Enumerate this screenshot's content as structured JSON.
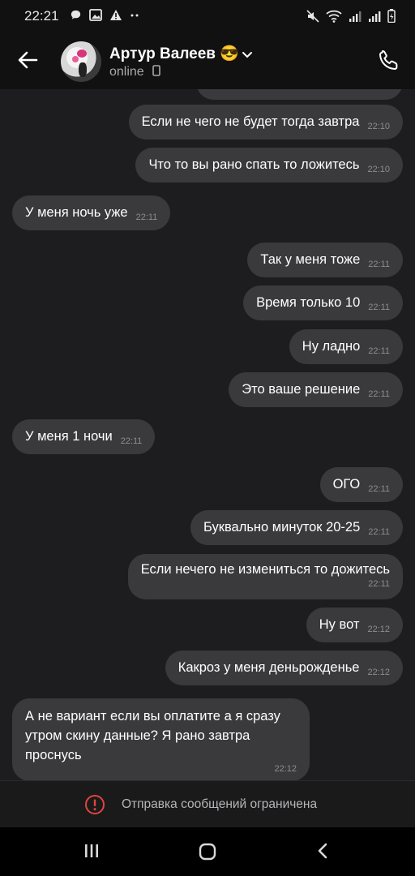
{
  "status_bar": {
    "time": "22:21",
    "left_icons": [
      "chat-bubble-icon",
      "image-icon",
      "warning-icon",
      "more-dots-icon"
    ],
    "right_icons": [
      "mute-icon",
      "wifi-icon",
      "signal-icon",
      "signal-icon",
      "battery-icon"
    ]
  },
  "header": {
    "contact_name": "Артур Валеев 😎",
    "presence": "online",
    "back_icon": "arrow-left-icon",
    "call_icon": "phone-icon"
  },
  "messages": [
    {
      "side": "out",
      "text": "Если не чего не будет тогда завтра",
      "time": "22:10"
    },
    {
      "side": "out",
      "text": "Что то вы рано спать то ложитесь",
      "time": "22:10"
    },
    {
      "side": "in",
      "text": "У меня ночь уже",
      "time": "22:11"
    },
    {
      "side": "out",
      "text": "Так у меня тоже",
      "time": "22:11"
    },
    {
      "side": "out",
      "text": "Время только 10",
      "time": "22:11"
    },
    {
      "side": "out",
      "text": "Ну ладно",
      "time": "22:11"
    },
    {
      "side": "out",
      "text": "Это ваше решение",
      "time": "22:11"
    },
    {
      "side": "in",
      "text": "У меня 1 ночи",
      "time": "22:11"
    },
    {
      "side": "out",
      "text": "ОГО",
      "time": "22:11"
    },
    {
      "side": "out",
      "text": "Буквально минуток 20-25",
      "time": "22:11"
    },
    {
      "side": "out",
      "text": "Если нечего не измениться то дожитесь",
      "time": "22:11"
    },
    {
      "side": "out",
      "text": "Ну вот",
      "time": "22:12"
    },
    {
      "side": "out",
      "text": "Какроз у меня деньрожденье",
      "time": "22:12"
    },
    {
      "side": "in",
      "text": "А не вариант если вы оплатите а я сразу утром скину данные? Я рано завтра проснусь",
      "time": "22:12"
    }
  ],
  "restriction": {
    "text": "Отправка сообщений ограничена",
    "icon": "alert-circle-icon",
    "accent": "#e0453f"
  },
  "navigation": {
    "icons": [
      "recent-apps-icon",
      "home-icon",
      "back-icon"
    ]
  },
  "colors": {
    "background": "#1d1d1f",
    "bubble": "#3a3a3c",
    "header": "#111112"
  }
}
